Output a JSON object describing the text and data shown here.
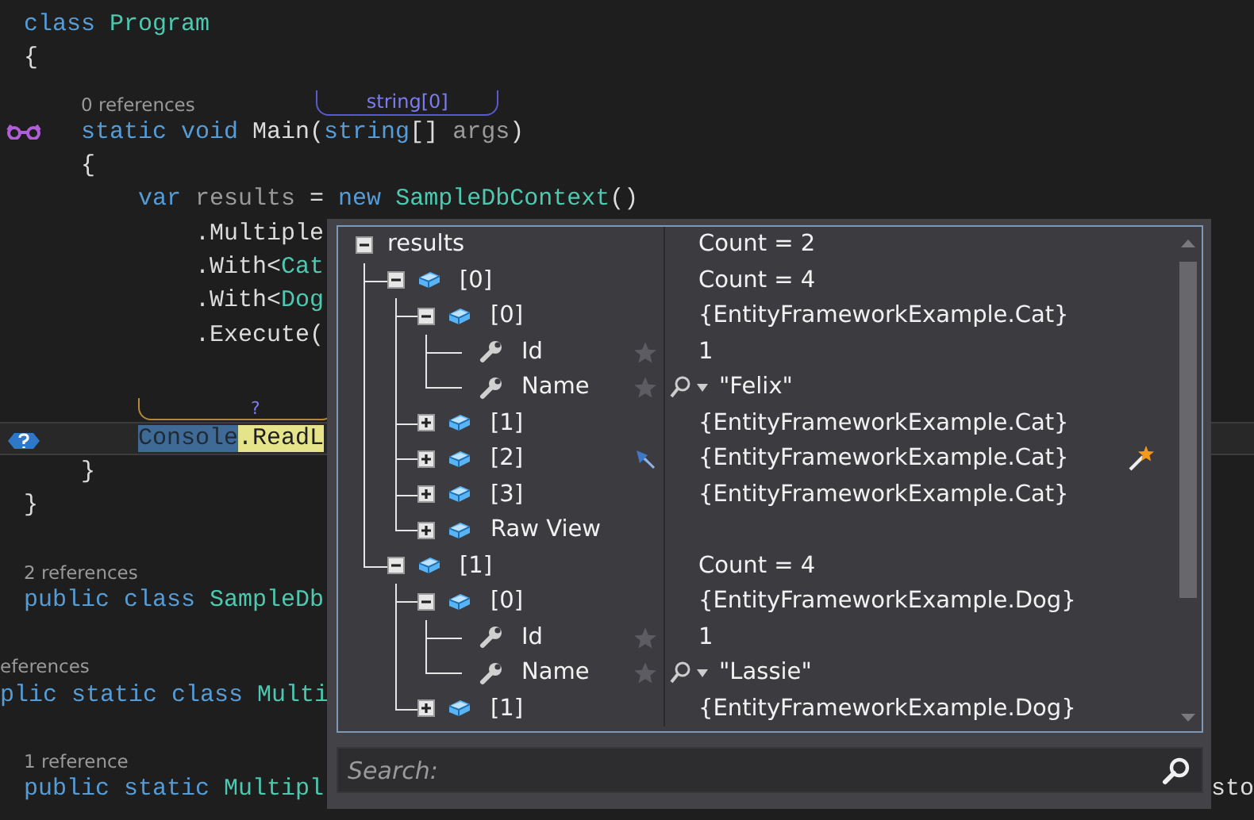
{
  "editor": {
    "lines": [
      {
        "kind": "code",
        "current": false,
        "tokens": [
          {
            "kind": "kw",
            "text": "class "
          },
          {
            "kind": "type",
            "text": "Program"
          }
        ]
      },
      {
        "kind": "code",
        "current": false,
        "tokens": [
          {
            "kind": "plain",
            "text": "{"
          }
        ],
        "children": [
          {
            "kind": "lens",
            "text": "0 references",
            "hint": "string[0]"
          },
          {
            "kind": "code",
            "current": false,
            "gutter": {
              "kind": "peek"
            },
            "tokens": [
              {
                "kind": "kw",
                "text": "static void "
              },
              {
                "kind": "plain",
                "text": "Main("
              },
              {
                "kind": "kw",
                "text": "string"
              },
              {
                "kind": "plain",
                "text": "[] "
              },
              {
                "kind": "param",
                "text": "args"
              },
              {
                "kind": "plain",
                "text": ")"
              }
            ]
          },
          {
            "kind": "code",
            "current": false,
            "tokens": [
              {
                "kind": "plain",
                "text": "{"
              }
            ],
            "children": [
              {
                "kind": "code",
                "current": false,
                "tokens": [
                  {
                    "kind": "kw",
                    "text": "var "
                  },
                  {
                    "kind": "param",
                    "text": "results"
                  },
                  {
                    "kind": "plain",
                    "text": " = "
                  },
                  {
                    "kind": "kw",
                    "text": "new "
                  },
                  {
                    "kind": "type",
                    "text": "SampleDbContext"
                  },
                  {
                    "kind": "plain",
                    "text": "()"
                  }
                ],
                "children": [
                  {
                    "kind": "code",
                    "current": false,
                    "tokens": [
                      {
                        "kind": "plain",
                        "text": ".Multiple"
                      }
                    ]
                  },
                  {
                    "kind": "code",
                    "current": false,
                    "tokens": [
                      {
                        "kind": "plain",
                        "text": ".With<"
                      },
                      {
                        "kind": "type",
                        "text": "Cat"
                      }
                    ]
                  },
                  {
                    "kind": "code",
                    "current": false,
                    "tokens": [
                      {
                        "kind": "plain",
                        "text": ".With<"
                      },
                      {
                        "kind": "type",
                        "text": "Dog"
                      }
                    ]
                  },
                  {
                    "kind": "code",
                    "current": false,
                    "tokens": [
                      {
                        "kind": "plain",
                        "text": ".Execute("
                      }
                    ]
                  }
                ]
              },
              {
                "kind": "blank"
              },
              {
                "kind": "hint",
                "text": "?"
              },
              {
                "kind": "code",
                "current": true,
                "gutter": {
                  "kind": "hint"
                },
                "tokens": [
                  {
                    "kind": "sel",
                    "text": "Console"
                  },
                  {
                    "kind": "hl",
                    "text": ".ReadL"
                  }
                ]
              }
            ]
          },
          {
            "kind": "code",
            "current": false,
            "tokens": [
              {
                "kind": "plain",
                "text": "}"
              }
            ]
          }
        ]
      },
      {
        "kind": "code",
        "current": false,
        "tokens": [
          {
            "kind": "plain",
            "text": "}"
          }
        ]
      },
      {
        "kind": "blank"
      },
      {
        "kind": "lens",
        "text": "2 references"
      },
      {
        "kind": "code",
        "current": false,
        "tokens": [
          {
            "kind": "kw",
            "text": "public class "
          },
          {
            "kind": "type",
            "text": "SampleDb"
          }
        ]
      },
      {
        "kind": "blank"
      },
      {
        "kind": "lens",
        "text": "eferences",
        "clipped": true
      },
      {
        "kind": "code",
        "current": false,
        "clipped": true,
        "tokens": [
          {
            "kind": "kw",
            "text": "plic static class "
          },
          {
            "kind": "type",
            "text": "Multi"
          }
        ]
      },
      {
        "kind": "blank"
      },
      {
        "kind": "lens",
        "text": "1 reference"
      },
      {
        "kind": "code",
        "current": false,
        "tokens": [
          {
            "kind": "kw",
            "text": "public static "
          },
          {
            "kind": "type",
            "text": "Multipl"
          }
        ],
        "tail": "sto"
      }
    ]
  },
  "datatip": {
    "tree": [
      {
        "kind": "variable",
        "name": "results",
        "value": "Count = 2",
        "expanded": true,
        "pinned": false,
        "wand": false,
        "children": [
          {
            "kind": "object",
            "name": "[0]",
            "value": "Count = 4",
            "expanded": true,
            "pinned": false,
            "wand": false,
            "children": [
              {
                "kind": "object",
                "name": "[0]",
                "value": "{EntityFrameworkExample.Cat}",
                "expanded": true,
                "pinned": false,
                "wand": false,
                "children": [
                  {
                    "kind": "property",
                    "name": "Id",
                    "value": "1",
                    "favorite": false,
                    "visualizer": false,
                    "pinned": false,
                    "wand": false
                  },
                  {
                    "kind": "property",
                    "name": "Name",
                    "value": "\"Felix\"",
                    "favorite": false,
                    "visualizer": true,
                    "pinned": false,
                    "wand": false
                  }
                ]
              },
              {
                "kind": "object",
                "name": "[1]",
                "value": "{EntityFrameworkExample.Cat}",
                "expanded": false,
                "pinned": false,
                "wand": false
              },
              {
                "kind": "object",
                "name": "[2]",
                "value": "{EntityFrameworkExample.Cat}",
                "expanded": false,
                "pinned": true,
                "wand": true
              },
              {
                "kind": "object",
                "name": "[3]",
                "value": "{EntityFrameworkExample.Cat}",
                "expanded": false,
                "pinned": false,
                "wand": false
              },
              {
                "kind": "object",
                "name": "Raw View",
                "expanded": false,
                "pinned": false,
                "wand": false
              }
            ]
          },
          {
            "kind": "object",
            "name": "[1]",
            "value": "Count = 4",
            "expanded": true,
            "pinned": false,
            "wand": false,
            "children": [
              {
                "kind": "object",
                "name": "[0]",
                "value": "{EntityFrameworkExample.Dog}",
                "expanded": true,
                "pinned": false,
                "wand": false,
                "children": [
                  {
                    "kind": "property",
                    "name": "Id",
                    "value": "1",
                    "favorite": false,
                    "visualizer": false,
                    "pinned": false,
                    "wand": false
                  },
                  {
                    "kind": "property",
                    "name": "Name",
                    "value": "\"Lassie\"",
                    "favorite": false,
                    "visualizer": true,
                    "pinned": false,
                    "wand": false
                  }
                ]
              },
              {
                "kind": "object",
                "name": "[1]",
                "value": "{EntityFrameworkExample.Dog}",
                "expanded": false,
                "pinned": false,
                "wand": false
              }
            ]
          }
        ]
      }
    ],
    "search": {
      "placeholder": "Search:"
    }
  }
}
